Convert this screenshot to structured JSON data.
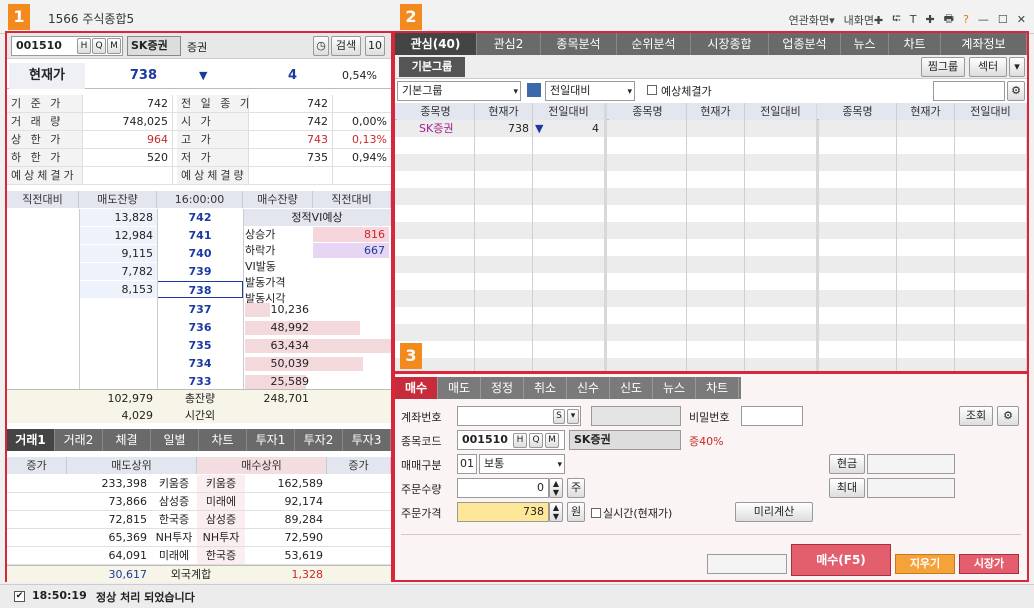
{
  "window": {
    "title": "1566 주식종합5",
    "menu": [
      "연관화면▾",
      "내화면✚",
      "⮓",
      "T",
      "✚",
      "🖶",
      "?",
      "—",
      "☐",
      "✕"
    ]
  },
  "badges": [
    "1",
    "2",
    "3"
  ],
  "stock": {
    "code": "001510",
    "name": "SK증권",
    "market": "증권",
    "search_label": "검색",
    "count": "10",
    "price_label": "현재가",
    "price": "738",
    "change_arrow": "▼",
    "change": "4",
    "rate": "0,54%"
  },
  "info": [
    {
      "l1": "기 준 가",
      "v1": "742",
      "l2": "전 일 종 가",
      "v2": "742",
      "p2": ""
    },
    {
      "l1": "거 래 량",
      "v1": "748,025",
      "l2": "시 가",
      "v2": "742",
      "p2": "0,00%"
    },
    {
      "l1": "상 한 가",
      "v1": "964",
      "l2": "고 가",
      "v2": "743",
      "p2": "0,13%"
    },
    {
      "l1": "하 한 가",
      "v1": "520",
      "l2": "저 가",
      "v2": "735",
      "p2": "0,94%"
    },
    {
      "l1": "예상체결가",
      "v1": "",
      "l2": "예상체결량",
      "v2": "",
      "p2": ""
    }
  ],
  "orderbook": {
    "headers": [
      "직전대비",
      "매도잔량",
      "16:00:00",
      "매수잔량",
      "직전대비"
    ],
    "asks": [
      {
        "q": "13,828",
        "p": "742"
      },
      {
        "q": "12,984",
        "p": "741"
      },
      {
        "q": "9,115",
        "p": "740"
      },
      {
        "q": "7,782",
        "p": "739"
      },
      {
        "q": "8,153",
        "p": "738"
      }
    ],
    "bids": [
      {
        "p": "737",
        "q": "10,236",
        "f": 0.17
      },
      {
        "p": "736",
        "q": "48,992",
        "f": 0.79
      },
      {
        "p": "735",
        "q": "63,434",
        "f": 1.0
      },
      {
        "p": "734",
        "q": "50,039",
        "f": 0.81
      },
      {
        "p": "733",
        "q": "25,589",
        "f": 0.42
      }
    ],
    "vi_title": "정적VI예상",
    "vi": [
      {
        "k": "상승가",
        "v": "816"
      },
      {
        "k": "하락가",
        "v": "667"
      },
      {
        "k": "VI발동",
        "v": ""
      },
      {
        "k": "발동가격",
        "v": ""
      },
      {
        "k": "발동시각",
        "v": ""
      }
    ],
    "total_ask": "102,979",
    "total_label": "총잔량",
    "total_bid": "248,701",
    "after_ask": "4,029",
    "after_label": "시간외"
  },
  "bottom_tabs": [
    "거래1",
    "거래2",
    "체결",
    "일별",
    "차트",
    "투자1",
    "투자2",
    "투자3"
  ],
  "broker": {
    "headers": [
      "증가",
      "매도상위",
      "매수상위",
      "증가"
    ],
    "rows": [
      {
        "sq": "233,398",
        "sn": "키움증",
        "bn": "키움증",
        "bq": "162,589"
      },
      {
        "sq": "73,866",
        "sn": "삼성증",
        "bn": "미래에",
        "bq": "92,174"
      },
      {
        "sq": "72,815",
        "sn": "한국증",
        "bn": "삼성증",
        "bq": "89,284"
      },
      {
        "sq": "65,369",
        "sn": "NH투자",
        "bn": "NH투자",
        "bq": "72,590"
      },
      {
        "sq": "64,091",
        "sn": "미래에",
        "bn": "한국증",
        "bq": "53,619"
      }
    ],
    "foreign_sell": "30,617",
    "foreign_label": "외국계합",
    "foreign_buy": "1,328"
  },
  "watch": {
    "tabs": [
      "관심(40)",
      "관심2",
      "종목분석",
      "순위분석",
      "시장종합",
      "업종분석",
      "뉴스",
      "차트",
      "계좌정보"
    ],
    "group_tab": "기본그룹",
    "btn_group": "찜그룹",
    "btn_sector": "섹터",
    "select_group": "기본그룹",
    "select_cmp": "전일대비",
    "expected_label": "예상체결가",
    "col_headers": [
      "종목명",
      "현재가",
      "전일대비"
    ],
    "rows": [
      {
        "name": "SK증권",
        "price": "738",
        "arrow": "▼",
        "chg": "4"
      }
    ]
  },
  "order": {
    "tabs": [
      "매수",
      "매도",
      "정정",
      "취소",
      "신수",
      "신도",
      "뉴스",
      "차트"
    ],
    "account_label": "계좌번호",
    "pw_label": "비밀번호",
    "inquiry": "조회",
    "code_label": "종목코드",
    "code": "001510",
    "name": "SK증권",
    "margin": "증40%",
    "type_label": "매매구분",
    "type_code": "01",
    "type_name": "보통",
    "cash": "현금",
    "max": "최대",
    "qty_label": "주문수량",
    "qty": "0",
    "qty_unit": "주",
    "price_label": "주문가격",
    "price": "738",
    "price_unit": "원",
    "realtime": "실시간(현재가)",
    "precalc": "미리계산",
    "buy_btn": "매수(F5)",
    "clear_btn": "지우기",
    "market_btn": "시장가"
  },
  "status": {
    "time": "18:50:19",
    "message": "정상 처리 되었습니다"
  }
}
